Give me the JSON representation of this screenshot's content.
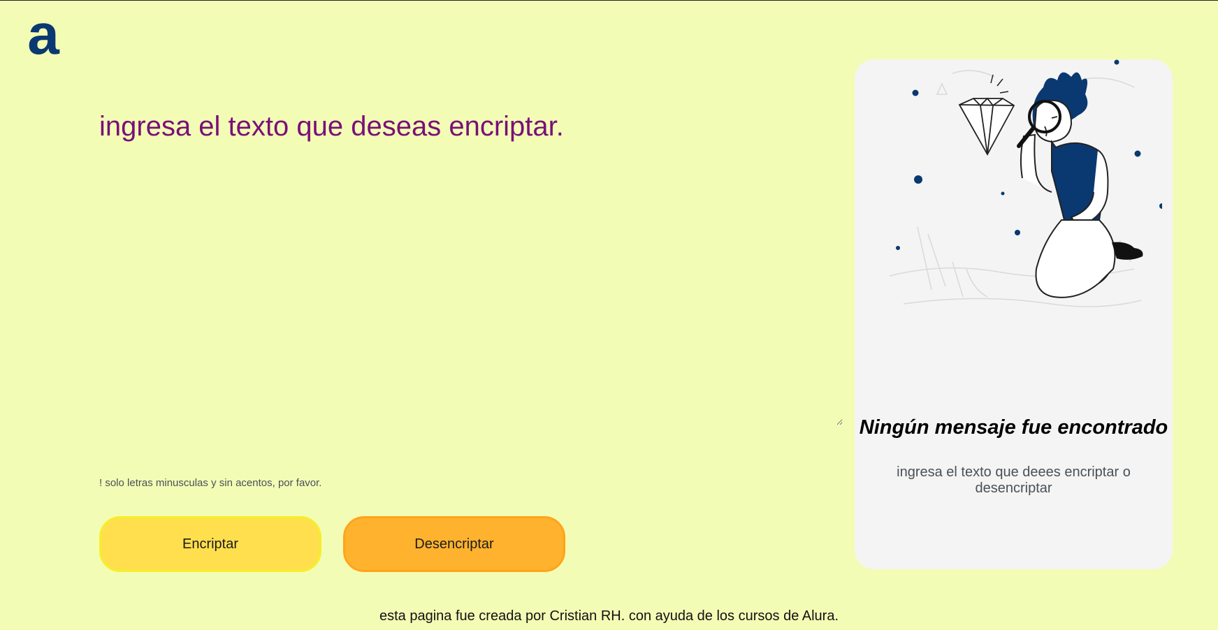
{
  "logo": {
    "icon": "alura-logo-icon",
    "color": "#0a3871",
    "glyph": "a"
  },
  "input": {
    "placeholder": "ingresa el texto que deseas encriptar.",
    "value": ""
  },
  "hint": {
    "text": "! solo letras minusculas y sin acentos, por favor."
  },
  "buttons": {
    "encrypt_label": "Encriptar",
    "decrypt_label": "Desencriptar"
  },
  "output_card": {
    "illustration": "person-with-magnifying-glass-and-diamond",
    "title": "Ningún mensaje fue encontrado",
    "subtitle": "ingresa el texto que deees encriptar o desencriptar"
  },
  "footer": {
    "text": "esta pagina fue creada por Cristian RH. con ayuda de los cursos de Alura."
  },
  "colors": {
    "background": "#f3fcb5",
    "accent_purple": "#7a0f78",
    "encrypt_button": "#ffdf4d",
    "decrypt_button": "#ffb22e",
    "card": "#f4f4f4",
    "brand_blue": "#0a3871"
  }
}
